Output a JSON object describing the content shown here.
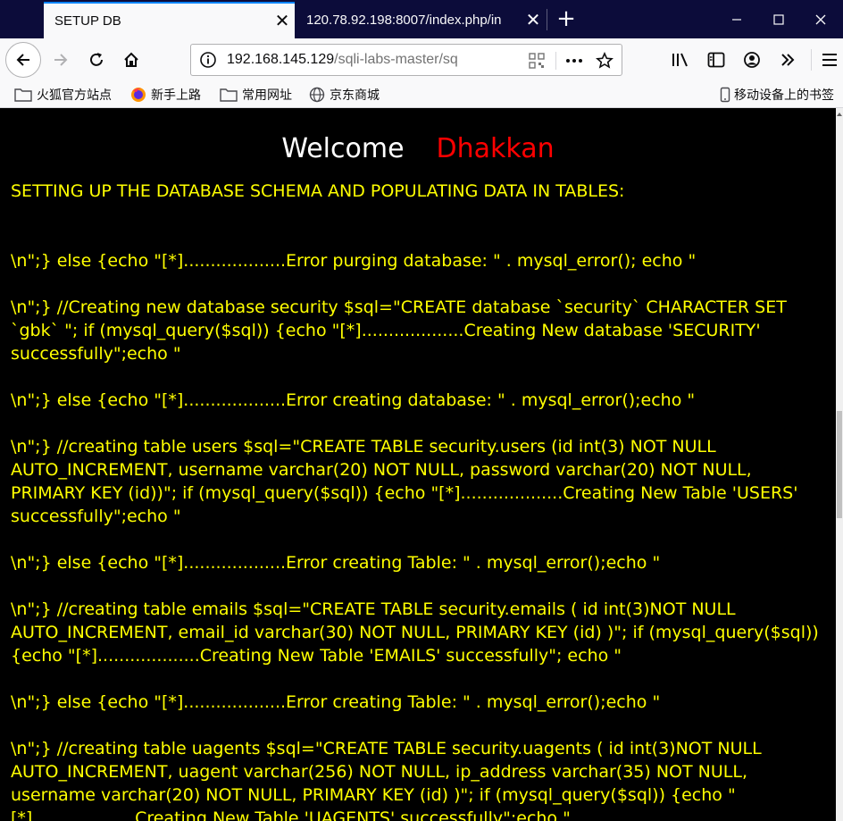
{
  "browser": {
    "tabs": [
      {
        "title": "SETUP DB",
        "active": true
      },
      {
        "title": "120.78.92.198:8007/index.php/in",
        "active": false
      }
    ],
    "url": {
      "host": "192.168.145.129",
      "path": "/sqli-labs-master/sq"
    },
    "bookmarks": [
      {
        "label": "火狐官方站点",
        "icon": "folder-icon"
      },
      {
        "label": "新手上路",
        "icon": "firefox-icon"
      },
      {
        "label": "常用网址",
        "icon": "folder-icon"
      },
      {
        "label": "京东商城",
        "icon": "globe-icon"
      }
    ],
    "mobile_bookmarks": "移动设备上的书签",
    "colors": {
      "tabbar": "#0c0c3a",
      "accent": "#0a84ff"
    }
  },
  "page": {
    "welcome": "Welcome",
    "name": "Dhakkan",
    "heading": "SETTING UP THE DATABASE SCHEMA AND POPULATING DATA IN TABLES:",
    "paragraphs": [
      "\\n\";} else {echo \"[*]...................Error purging database: \" . mysql_error(); echo \"",
      "\\n\";} //Creating new database security $sql=\"CREATE database `security` CHARACTER SET `gbk` \"; if (mysql_query($sql)) {echo \"[*]...................Creating New database 'SECURITY' successfully\";echo \"",
      "\\n\";} else {echo \"[*]...................Error creating database: \" . mysql_error();echo \"",
      "\\n\";} //creating table users $sql=\"CREATE TABLE security.users (id int(3) NOT NULL AUTO_INCREMENT, username varchar(20) NOT NULL, password varchar(20) NOT NULL, PRIMARY KEY (id))\"; if (mysql_query($sql)) {echo \"[*]...................Creating New Table 'USERS' successfully\";echo \"",
      "\\n\";} else {echo \"[*]...................Error creating Table: \" . mysql_error();echo \"",
      "\\n\";} //creating table emails $sql=\"CREATE TABLE security.emails ( id int(3)NOT NULL AUTO_INCREMENT, email_id varchar(30) NOT NULL, PRIMARY KEY (id) )\"; if (mysql_query($sql)) {echo \"[*]...................Creating New Table 'EMAILS' successfully\"; echo \"",
      "\\n\";} else {echo \"[*]...................Error creating Table: \" . mysql_error();echo \"",
      "\\n\";} //creating table uagents $sql=\"CREATE TABLE security.uagents ( id int(3)NOT NULL AUTO_INCREMENT, uagent varchar(256) NOT NULL, ip_address varchar(35) NOT NULL, username varchar(20) NOT NULL, PRIMARY KEY (id) )\"; if (mysql_query($sql)) {echo \"[*]...................Creating New Table 'UAGENTS' successfully\";echo \""
    ],
    "colors": {
      "background": "#000000",
      "text": "#ffff00",
      "welcome": "#ffffff",
      "name": "#ff0000"
    }
  }
}
